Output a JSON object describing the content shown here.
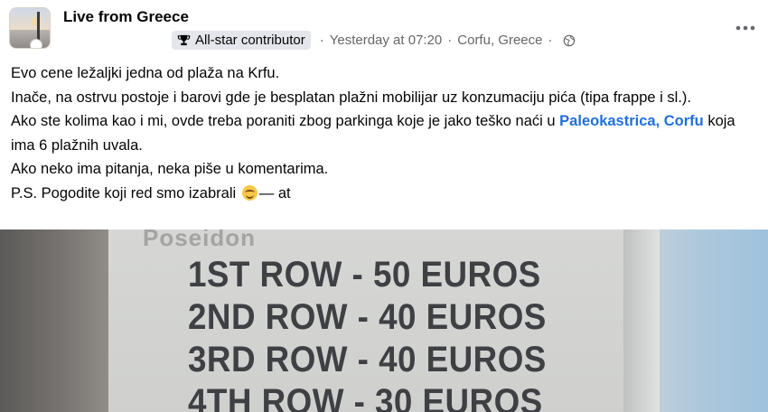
{
  "post": {
    "group_name": "Live from Greece",
    "contributor_badge": "All-star contributor",
    "timestamp": "Yesterday at 07:20",
    "location": "Corfu, Greece",
    "separator": "·",
    "more_icon": "more-options-icon",
    "privacy_icon": "globe-icon"
  },
  "body": {
    "line1": "Evo cene ležaljki jedna od plaža na Krfu.",
    "line2": "Inače, na ostrvu postoje i barovi gde je besplatan plažni mobilijar uz konzumaciju pića (tipa frappe i sl.).",
    "line3_before": "Ako ste kolima kao i mi, ovde treba poraniti zbog parkinga koje je jako teško naći u ",
    "line3_link": "Paleokastrica, Corfu",
    "line3_after": " koja ima 6 plažnih uvala.",
    "line4": "Ako neko ima pitanja, neka piše u komentarima.",
    "line5_before": "P.S. Pogodite koji red smo izabrali ",
    "line5_after": "— at"
  },
  "photo": {
    "header": "Poseidon",
    "rows": [
      "1ST ROW - 50 EUROS",
      "2ND ROW - 40 EUROS",
      "3RD ROW - 40 EUROS",
      "4TH ROW - 30 EUROS"
    ]
  },
  "colors": {
    "link": "#216fdb",
    "meta": "#65676b",
    "chip_bg": "#e4e6eb",
    "sign_text": "#3f4044"
  }
}
